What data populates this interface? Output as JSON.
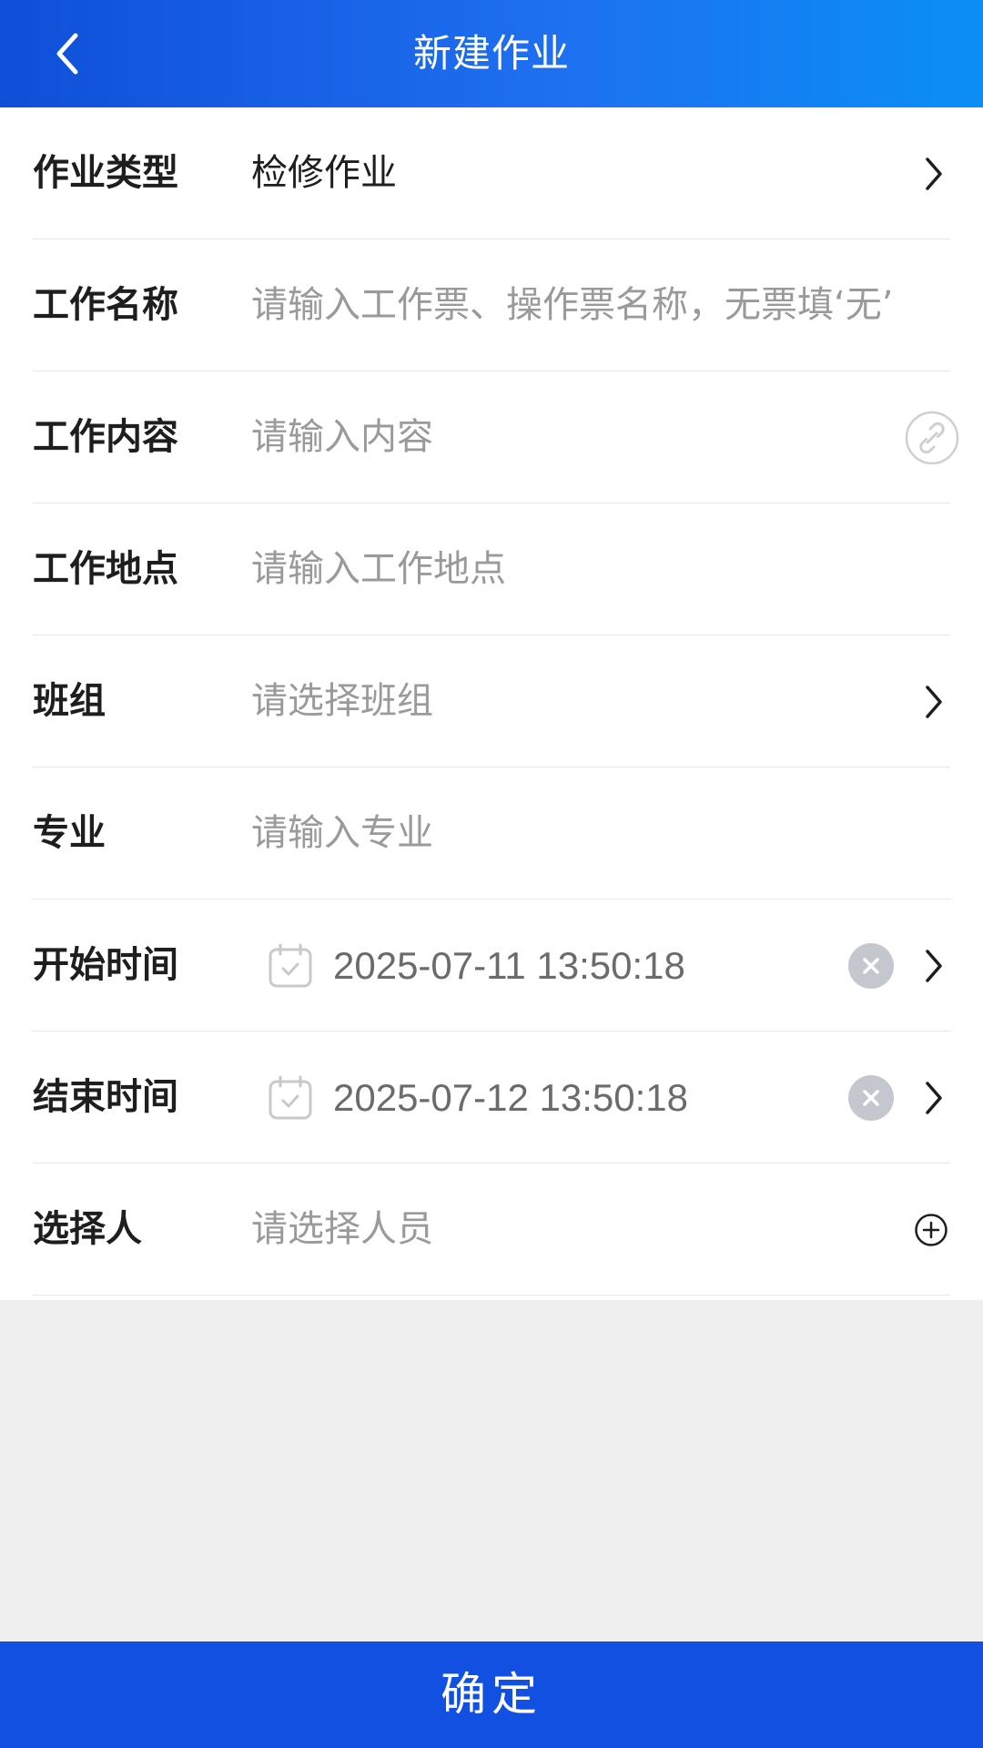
{
  "header": {
    "title": "新建作业",
    "back_icon": "chevron-left-icon"
  },
  "form": {
    "work_type": {
      "label": "作业类型",
      "value": "检修作业"
    },
    "work_name": {
      "label": "工作名称",
      "placeholder": "请输入工作票、操作票名称，无票填‘无’"
    },
    "work_content": {
      "label": "工作内容",
      "placeholder": "请输入内容"
    },
    "work_location": {
      "label": "工作地点",
      "placeholder": "请输入工作地点"
    },
    "team": {
      "label": "班组",
      "placeholder": "请选择班组"
    },
    "specialty": {
      "label": "专业",
      "placeholder": "请输入专业"
    },
    "start_time": {
      "label": "开始时间",
      "value": "2025-07-11 13:50:18"
    },
    "end_time": {
      "label": "结束时间",
      "value": "2025-07-12 13:50:18"
    },
    "selector": {
      "label": "选择人",
      "placeholder": "请选择人员"
    }
  },
  "footer": {
    "confirm_label": "确定"
  },
  "colors": {
    "header_start": "#0f4fd8",
    "header_end": "#0a8ff5",
    "footer_bg": "#1150e0",
    "placeholder": "#9a9a9a",
    "clear_button": "#c4c7cd"
  }
}
